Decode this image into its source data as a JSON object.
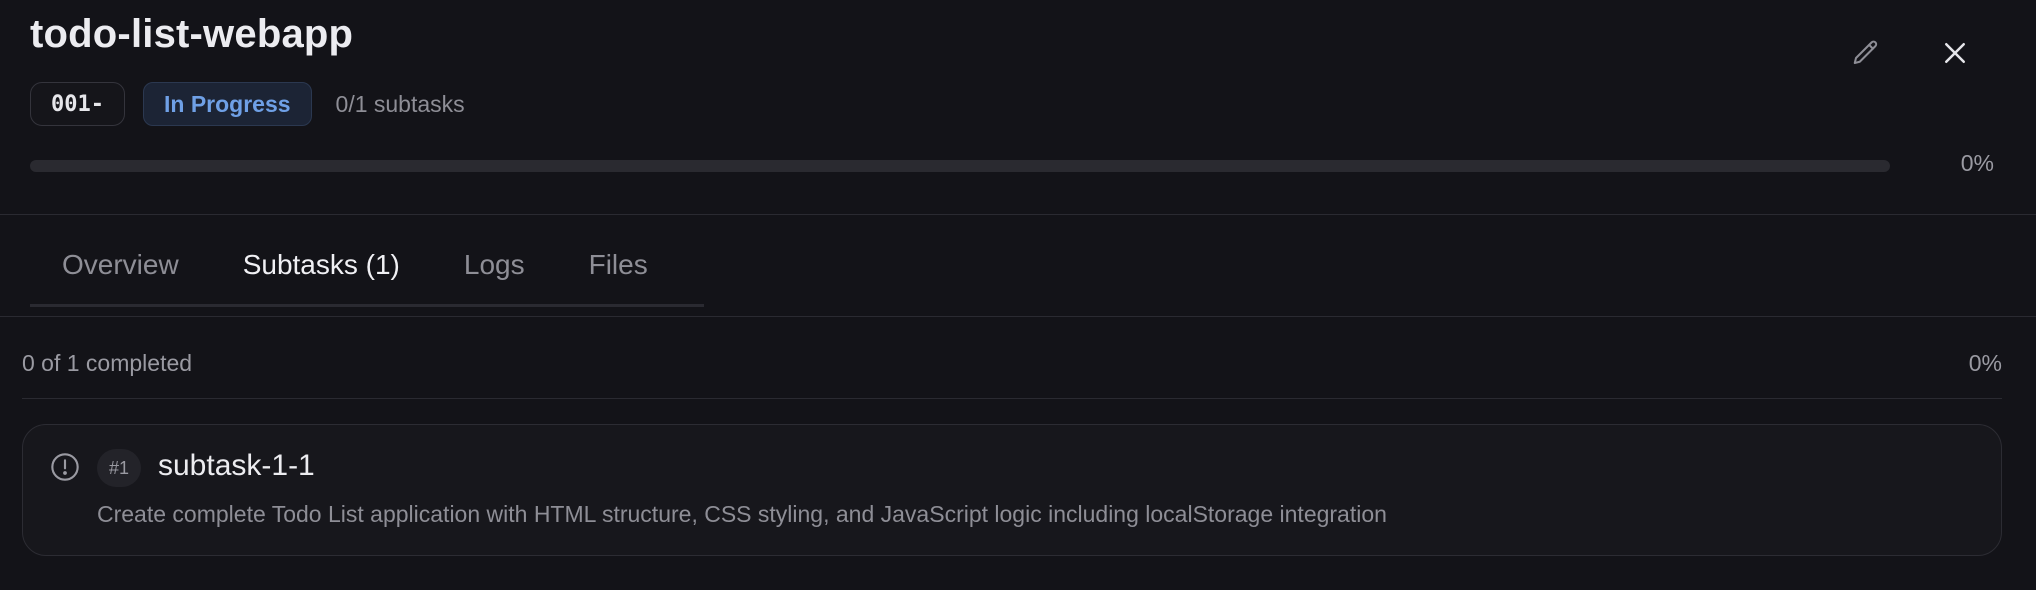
{
  "task": {
    "title": "todo-list-webapp",
    "id_label": "001-",
    "status": "In Progress",
    "subtask_count": "0/1 subtasks",
    "progress_percent": 0,
    "progress_label": "0%"
  },
  "tabs": [
    {
      "label": "Overview",
      "active": false
    },
    {
      "label": "Subtasks (1)",
      "active": true
    },
    {
      "label": "Logs",
      "active": false
    },
    {
      "label": "Files",
      "active": false
    }
  ],
  "subtasks_panel": {
    "summary": "0 of 1 completed",
    "summary_pct": "0%",
    "items": [
      {
        "number": "#1",
        "title": "subtask-1-1",
        "description": "Create complete Todo List application with HTML structure, CSS styling, and JavaScript logic including localStorage integration",
        "status_icon": "alert-circle-icon"
      }
    ]
  },
  "icons": {
    "edit": "pencil-icon",
    "close": "close-icon"
  },
  "colors": {
    "background": "#131318",
    "accent": "#6fa0e6",
    "status_badge_bg": "#1c2435"
  }
}
